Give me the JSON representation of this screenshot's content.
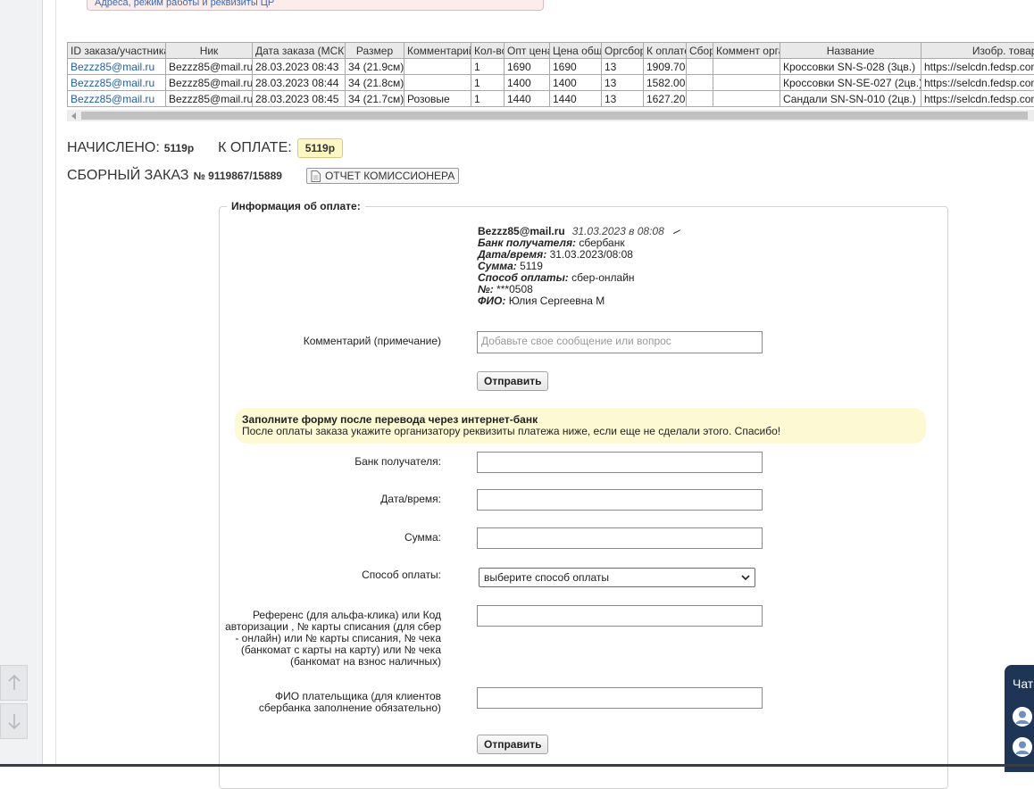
{
  "top_alert": "Адреса, режим работы и реквизиты ЦР",
  "table": {
    "headers": [
      "ID заказа/участника",
      "Ник",
      "Дата заказа (МСК)",
      "Размер",
      "Комментарий",
      "Кол-во",
      "Опт цена",
      "Цена общ.",
      "Оргсбор",
      "К оплате",
      "Сбор",
      "Коммент орга",
      "Название",
      "Изобр. товара"
    ],
    "rows": [
      [
        "Bezzz85@mail.ru",
        "Bezzz85@mail.ru",
        "28.03.2023 08:43",
        "34 (21.9см)",
        "",
        "1",
        "1690",
        "1690",
        "13",
        "1909.70",
        "",
        "",
        "Кроссовки SN-S-028 (3цв.)",
        "https://selcdn.fedsp.com"
      ],
      [
        "Bezzz85@mail.ru",
        "Bezzz85@mail.ru",
        "28.03.2023 08:44",
        "34 (21.8см)",
        "",
        "1",
        "1400",
        "1400",
        "13",
        "1582.00",
        "",
        "",
        "Кроссовки SN-SE-027 (2цв.)",
        "https://selcdn.fedsp.com"
      ],
      [
        "Bezzz85@mail.ru",
        "Bezzz85@mail.ru",
        "28.03.2023 08:45",
        "34 (21.7см)",
        "Розовые",
        "1",
        "1440",
        "1440",
        "13",
        "1627.20",
        "",
        "",
        "Сандали SN-SN-010 (2цв.)",
        "https://selcdn.fedsp.com"
      ]
    ]
  },
  "summary": {
    "accrued_label": "НАЧИСЛЕНО:",
    "accrued_value": "5119р",
    "to_pay_label": "К ОПЛАТЕ:",
    "to_pay_value": "5119р"
  },
  "combined_order": {
    "label": "СБОРНЫЙ ЗАКАЗ",
    "number": "№ 9119867/15889",
    "report_button": "ОТЧЕТ КОМИССИОНЕРА"
  },
  "payment_info": {
    "legend": "Информация об оплате:",
    "email": "Bezzz85@mail.ru",
    "date": "31.03.2023 в 08:08",
    "fields": [
      {
        "k": "Банк получателя:",
        "v": "сбербанк"
      },
      {
        "k": "Дата/время:",
        "v": "31.03.2023/08:08"
      },
      {
        "k": "Сумма:",
        "v": "5119"
      },
      {
        "k": "Способ оплаты:",
        "v": "сбер-онлайн"
      },
      {
        "k": "№:",
        "v": "***0508"
      },
      {
        "k": "ФИО:",
        "v": "Юлия Сергеевна М"
      }
    ]
  },
  "comment": {
    "label": "Комментарий (примечание)",
    "placeholder": "Добавьте свое сообщение или вопрос",
    "submit": "Отправить"
  },
  "notice": {
    "title": "Заполните форму после перевода через интернет-банк",
    "text": "После оплаты заказа укажите организатору реквизиты платежа ниже, если еще не сделали этого. Спасибо!"
  },
  "form": {
    "bank_label": "Банк получателя:",
    "datetime_label": "Дата/время:",
    "sum_label": "Сумма:",
    "method_label": "Способ оплаты:",
    "method_selected": "выберите способ оплаты",
    "reference_label": "Референс (для альфа-клика) или Код авторизации , № карты списания (для сбер - онлайн) или № карты списания, № чека (банкомат с карты на карту) или № чека (банкомат на взнос наличных)",
    "payer_label": "ФИО плательщика (для клиентов сбербанка заполнение обязательно)",
    "submit": "Отправить"
  },
  "chat": {
    "title": "Чат"
  },
  "colors": {
    "link": "#1f5fb0",
    "notice_bg": "#fcf9d3",
    "badge_bg": "#fdf7c4",
    "chat_bg": "#1f3555"
  }
}
